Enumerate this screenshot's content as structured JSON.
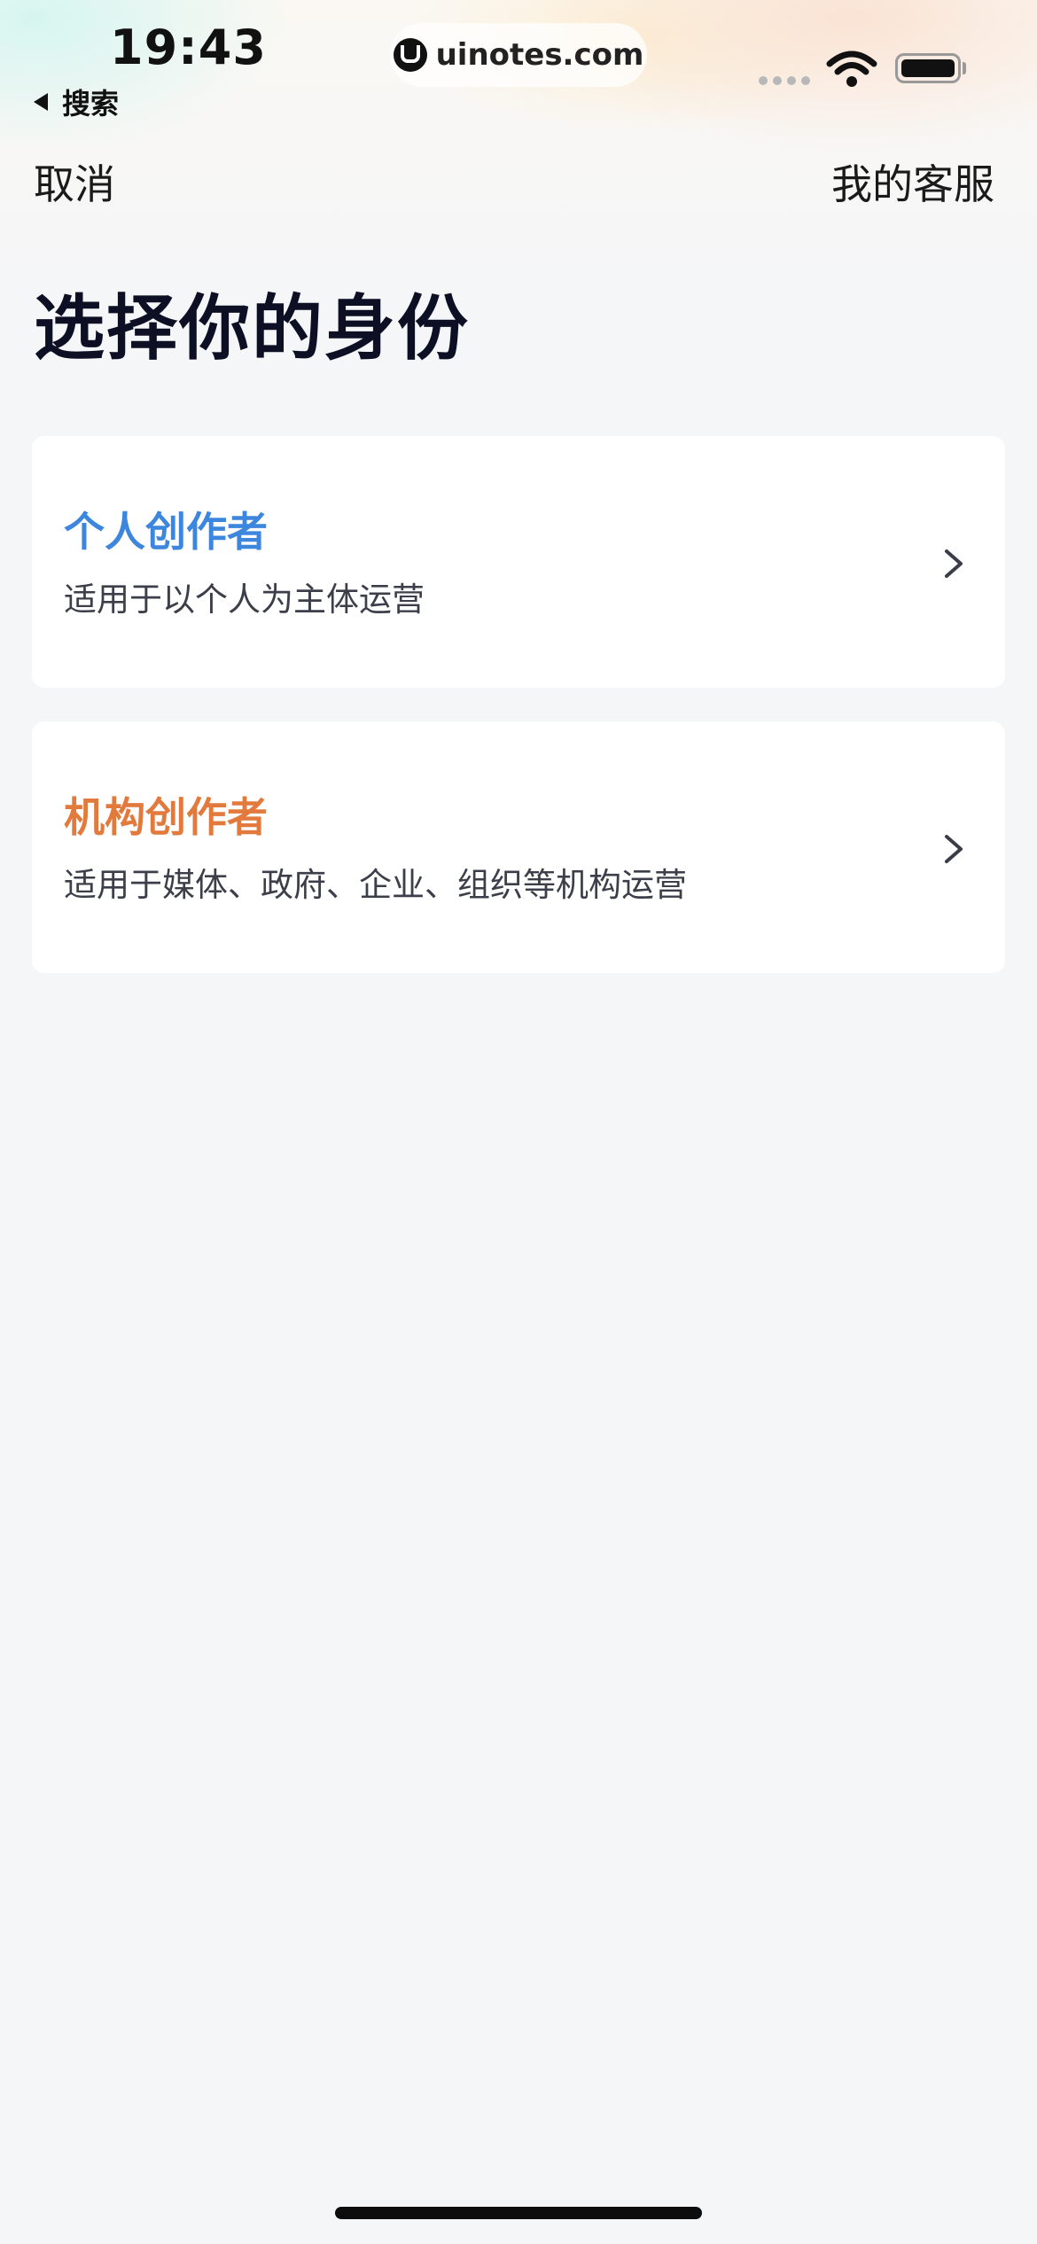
{
  "status_bar": {
    "time": "19:43",
    "back_label": "搜索",
    "url": "uinotes.com"
  },
  "nav": {
    "cancel_label": "取消",
    "service_label": "我的客服"
  },
  "page": {
    "title": "选择你的身份"
  },
  "options": [
    {
      "title": "个人创作者",
      "description": "适用于以个人为主体运营",
      "color": "#3d86dd"
    },
    {
      "title": "机构创作者",
      "description": "适用于媒体、政府、企业、组织等机构运营",
      "color": "#e27a3d"
    }
  ],
  "icons": {
    "chevron": "chevron-right-icon",
    "wifi": "wifi-icon",
    "battery": "battery-icon"
  }
}
